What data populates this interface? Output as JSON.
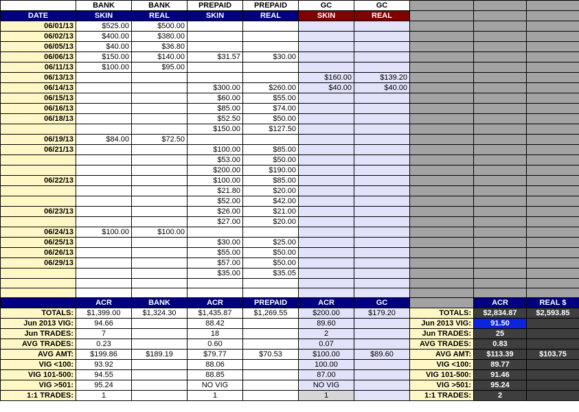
{
  "header": {
    "row1": [
      "",
      "BANK",
      "BANK",
      "PREPAID",
      "PREPAID",
      "GC",
      "GC"
    ],
    "row2": [
      "DATE",
      "SKIN",
      "REAL",
      "SKIN",
      "REAL",
      "SKIN",
      "REAL"
    ]
  },
  "rows": [
    [
      "06/01/13",
      "$525.00",
      "$500.00",
      "",
      "",
      "",
      ""
    ],
    [
      "06/02/13",
      "$400.00",
      "$380.00",
      "",
      "",
      "",
      ""
    ],
    [
      "06/05/13",
      "$40.00",
      "$36.80",
      "",
      "",
      "",
      ""
    ],
    [
      "06/06/13",
      "$150.00",
      "$140.00",
      "$31.57",
      "$30.00",
      "",
      ""
    ],
    [
      "06/11/13",
      "$100.00",
      "$95.00",
      "",
      "",
      "",
      ""
    ],
    [
      "06/13/13",
      "",
      "",
      "",
      "",
      "$160.00",
      "$139.20"
    ],
    [
      "06/14/13",
      "",
      "",
      "$300.00",
      "$260.00",
      "$40.00",
      "$40.00"
    ],
    [
      "06/15/13",
      "",
      "",
      "$60.00",
      "$55.00",
      "",
      ""
    ],
    [
      "06/16/13",
      "",
      "",
      "$85.00",
      "$74.00",
      "",
      ""
    ],
    [
      "06/18/13",
      "",
      "",
      "$52.50",
      "$50.00",
      "",
      ""
    ],
    [
      "",
      "",
      "",
      "$150.00",
      "$127.50",
      "",
      ""
    ],
    [
      "06/19/13",
      "$84.00",
      "$72.50",
      "",
      "",
      "",
      ""
    ],
    [
      "06/21/13",
      "",
      "",
      "$100.00",
      "$85.00",
      "",
      ""
    ],
    [
      "",
      "",
      "",
      "$53.00",
      "$50.00",
      "",
      ""
    ],
    [
      "",
      "",
      "",
      "$200.00",
      "$190.00",
      "",
      ""
    ],
    [
      "06/22/13",
      "",
      "",
      "$100.00",
      "$85.00",
      "",
      ""
    ],
    [
      "",
      "",
      "",
      "$21.80",
      "$20.00",
      "",
      ""
    ],
    [
      "",
      "",
      "",
      "$52.00",
      "$42.00",
      "",
      ""
    ],
    [
      "06/23/13",
      "",
      "",
      "$26.00",
      "$21.00",
      "",
      ""
    ],
    [
      "",
      "",
      "",
      "$27.00",
      "$20.00",
      "",
      ""
    ],
    [
      "06/24/13",
      "$100.00",
      "$100.00",
      "",
      "",
      "",
      ""
    ],
    [
      "06/25/13",
      "",
      "",
      "$30.00",
      "$25.00",
      "",
      ""
    ],
    [
      "06/26/13",
      "",
      "",
      "$55.00",
      "$50.00",
      "",
      ""
    ],
    [
      "06/29/13",
      "",
      "",
      "$57.00",
      "$50.00",
      "",
      ""
    ],
    [
      "",
      "",
      "",
      "$35.00",
      "$35.05",
      "",
      ""
    ],
    [
      "",
      "",
      "",
      "",
      "",
      "",
      ""
    ],
    [
      "",
      "",
      "",
      "",
      "",
      "",
      ""
    ]
  ],
  "summary_header": {
    "left": [
      "",
      "ACR",
      "BANK",
      "ACR",
      "PREPAID",
      "ACR",
      "GC"
    ],
    "right": [
      "",
      "ACR",
      "REAL $"
    ]
  },
  "summary": [
    {
      "label": "TOTALS:",
      "cells": [
        "$1,399.00",
        "$1,324.30",
        "$1,435.87",
        "$1,269.55",
        "$200.00",
        "$179.20"
      ],
      "rlabel": "TOTALS:",
      "rcells": [
        "$2,834.87",
        "$2,593.85"
      ]
    },
    {
      "label": "Jun 2013 VIG:",
      "cells": [
        "94.66",
        "",
        "88.42",
        "",
        "89.60",
        ""
      ],
      "rlabel": "Jun 2013 VIG:",
      "rcells": [
        "91.50",
        ""
      ]
    },
    {
      "label": "Jun TRADES:",
      "cells": [
        "7",
        "",
        "18",
        "",
        "2",
        ""
      ],
      "rlabel": "Jun TRADES:",
      "rcells": [
        "25",
        ""
      ]
    },
    {
      "label": "AVG TRADES:",
      "cells": [
        "0.23",
        "",
        "0.60",
        "",
        "0.07",
        ""
      ],
      "rlabel": "AVG TRADES:",
      "rcells": [
        "0.83",
        ""
      ]
    },
    {
      "label": "AVG AMT:",
      "cells": [
        "$199.86",
        "$189.19",
        "$79.77",
        "$70.53",
        "$100.00",
        "$89.60"
      ],
      "rlabel": "AVG AMT:",
      "rcells": [
        "$113.39",
        "$103.75"
      ]
    },
    {
      "label": "VIG <100:",
      "cells": [
        "93.92",
        "",
        "88.06",
        "",
        "100.00",
        ""
      ],
      "rlabel": "VIG <100:",
      "rcells": [
        "89.77",
        ""
      ]
    },
    {
      "label": "VIG 101-500:",
      "cells": [
        "94.55",
        "",
        "88.85",
        "",
        "87.00",
        ""
      ],
      "rlabel": "VIG 101-500:",
      "rcells": [
        "91.46",
        ""
      ]
    },
    {
      "label": "VIG >501:",
      "cells": [
        "95.24",
        "",
        "NO VIG",
        "",
        "NO VIG",
        ""
      ],
      "rlabel": "VIG >501:",
      "rcells": [
        "95.24",
        ""
      ]
    },
    {
      "label": "1:1 TRADES:",
      "cells": [
        "1",
        "",
        "1",
        "",
        "1",
        ""
      ],
      "rlabel": "1:1 TRADES:",
      "rcells": [
        "2",
        ""
      ]
    }
  ],
  "colors": {
    "navy": "#000080",
    "maroon": "#800000",
    "date_bg": "#fff8c6",
    "gc_bg": "#e2e2fa",
    "gray": "#a3a3a3",
    "dark": "#3e3e3e",
    "highlight": "#0a24e0"
  }
}
